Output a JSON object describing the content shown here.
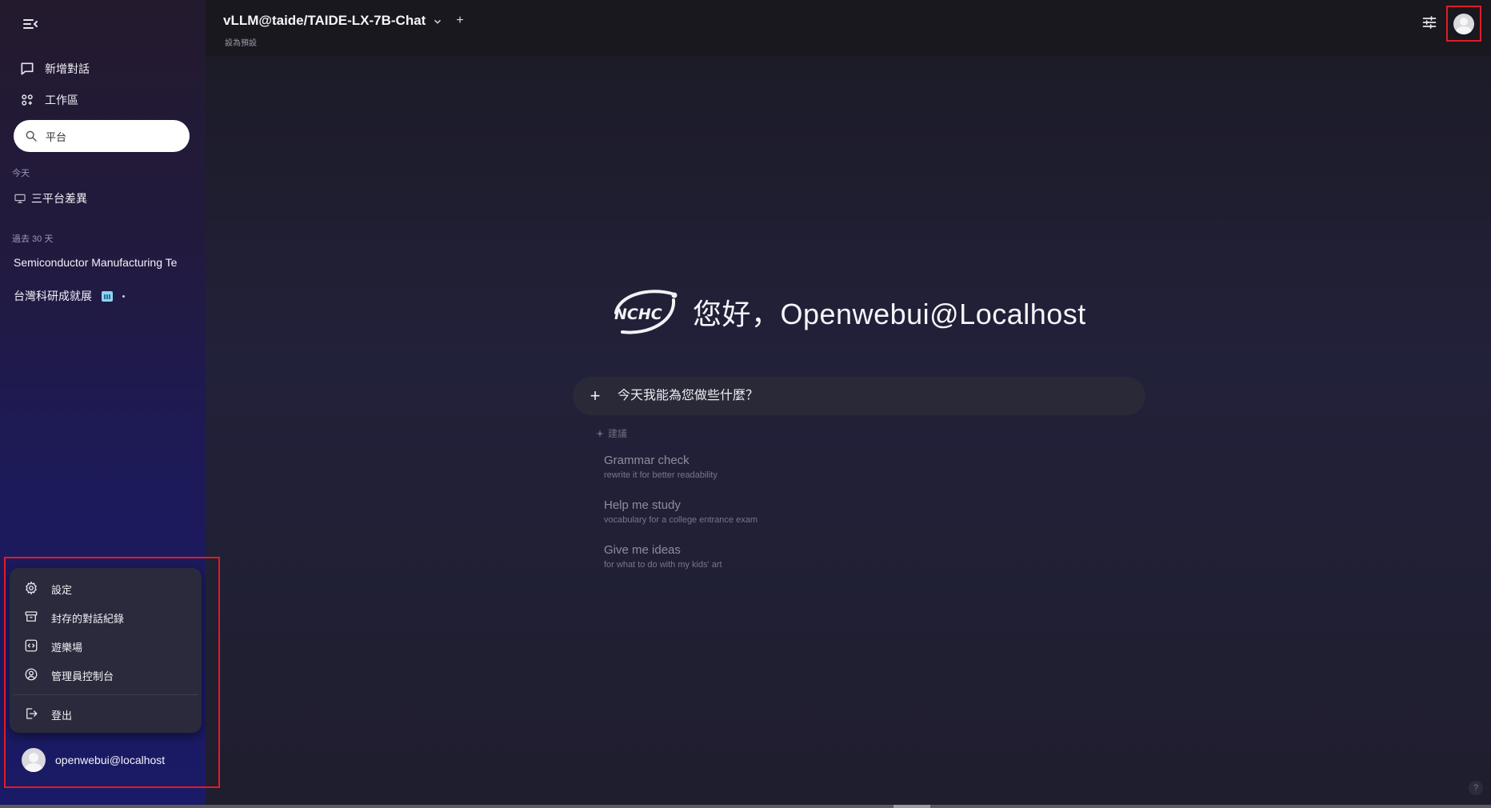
{
  "header": {
    "model_name": "vLLM@taide/TAIDE-LX-7B-Chat",
    "add_model": "+",
    "set_default": "設為預設"
  },
  "sidebar": {
    "new_chat": "新增對話",
    "workspace": "工作區",
    "search_value": "平台",
    "section_today": "今天",
    "section_past": "過去 30 天",
    "chats_today": [
      {
        "title": "三平台差異"
      }
    ],
    "chats_past": [
      {
        "title": "Semiconductor Manufacturing Te"
      },
      {
        "title": "台灣科研成就展"
      }
    ]
  },
  "user_menu": {
    "settings": "設定",
    "archived": "封存的對話紀錄",
    "playground": "遊樂場",
    "admin": "管理員控制台",
    "logout": "登出"
  },
  "user": {
    "name": "openwebui@localhost"
  },
  "main": {
    "greeting": "您好，Openwebui@Localhost",
    "logo_text": "NCHC",
    "prompt_placeholder": "今天我能為您做些什麼？",
    "suggestions_label": "建議",
    "suggestions": [
      {
        "title": "Grammar check",
        "subtitle": "rewrite it for better readability"
      },
      {
        "title": "Help me study",
        "subtitle": "vocabulary for a college entrance exam"
      },
      {
        "title": "Give me ideas",
        "subtitle": "for what to do with my kids' art"
      }
    ],
    "help": "?"
  },
  "colors": {
    "highlight": "#e21b24",
    "sidebar_bottom": "#1a1a66"
  }
}
